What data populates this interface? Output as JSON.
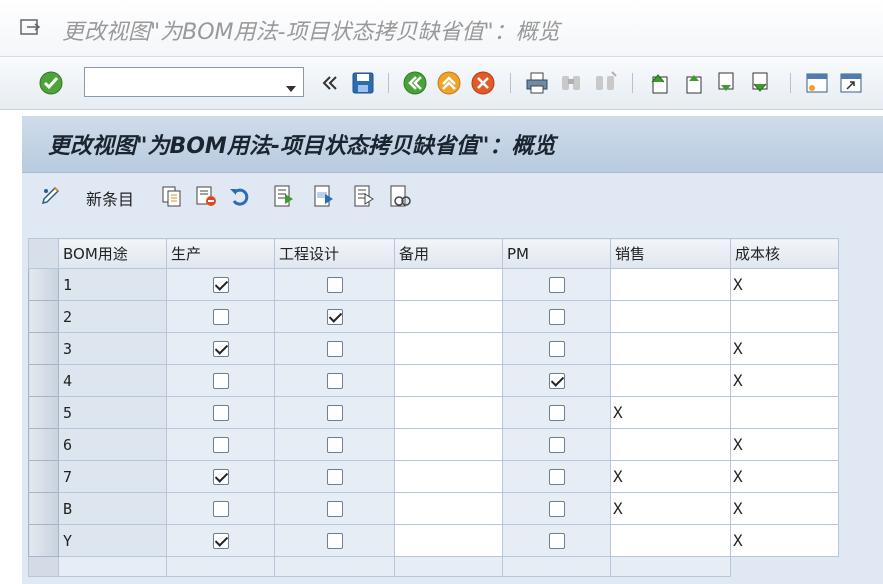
{
  "window": {
    "title": "更改视图\"为BOM用法-项目状态拷贝缺省值\"：概览"
  },
  "toolbar": {
    "command_field_value": "",
    "command_field_placeholder": "",
    "icons": [
      "enter-icon",
      "command-dropdown-icon",
      "collapse-icon",
      "save-icon",
      "back-icon",
      "exit-icon",
      "cancel-icon",
      "print-icon",
      "find-icon",
      "find-next-icon",
      "first-page-icon",
      "previous-page-icon",
      "next-page-icon",
      "last-page-icon",
      "new-session-icon",
      "shortcut-icon"
    ]
  },
  "screen": {
    "title": "更改视图\"为BOM用法-项目状态拷贝缺省值\"：概览",
    "new_entries_label": "新条目",
    "app_icons": [
      "display-change-icon",
      "copy-as-icon",
      "delete-icon",
      "undo-icon",
      "select-all-icon",
      "select-block-icon",
      "deselect-all-icon",
      "configuration-icon"
    ]
  },
  "table": {
    "columns": [
      "BOM用途",
      "生产",
      "工程设计",
      "备用",
      "PM",
      "销售",
      "成本核"
    ],
    "rows": [
      {
        "usage": "1",
        "production": true,
        "engineering": false,
        "spare": "",
        "pm": false,
        "sales": "",
        "costing": "X"
      },
      {
        "usage": "2",
        "production": false,
        "engineering": true,
        "spare": "",
        "pm": false,
        "sales": "",
        "costing": ""
      },
      {
        "usage": "3",
        "production": true,
        "engineering": false,
        "spare": "",
        "pm": false,
        "sales": "",
        "costing": "X"
      },
      {
        "usage": "4",
        "production": false,
        "engineering": false,
        "spare": "",
        "pm": true,
        "sales": "",
        "costing": "X"
      },
      {
        "usage": "5",
        "production": false,
        "engineering": false,
        "spare": "",
        "pm": false,
        "sales": "X",
        "costing": ""
      },
      {
        "usage": "6",
        "production": false,
        "engineering": false,
        "spare": "",
        "pm": false,
        "sales": "",
        "costing": "X"
      },
      {
        "usage": "7",
        "production": true,
        "engineering": false,
        "spare": "",
        "pm": false,
        "sales": "X",
        "costing": "X"
      },
      {
        "usage": "B",
        "production": false,
        "engineering": false,
        "spare": "",
        "pm": false,
        "sales": "X",
        "costing": "X"
      },
      {
        "usage": "Y",
        "production": true,
        "engineering": false,
        "spare": "",
        "pm": false,
        "sales": "",
        "costing": "X"
      }
    ]
  },
  "colors": {
    "accent_green": "#3c9a2e",
    "accent_orange": "#e8941c",
    "accent_red": "#d9481f",
    "header_blue": "#c3d3e6"
  }
}
